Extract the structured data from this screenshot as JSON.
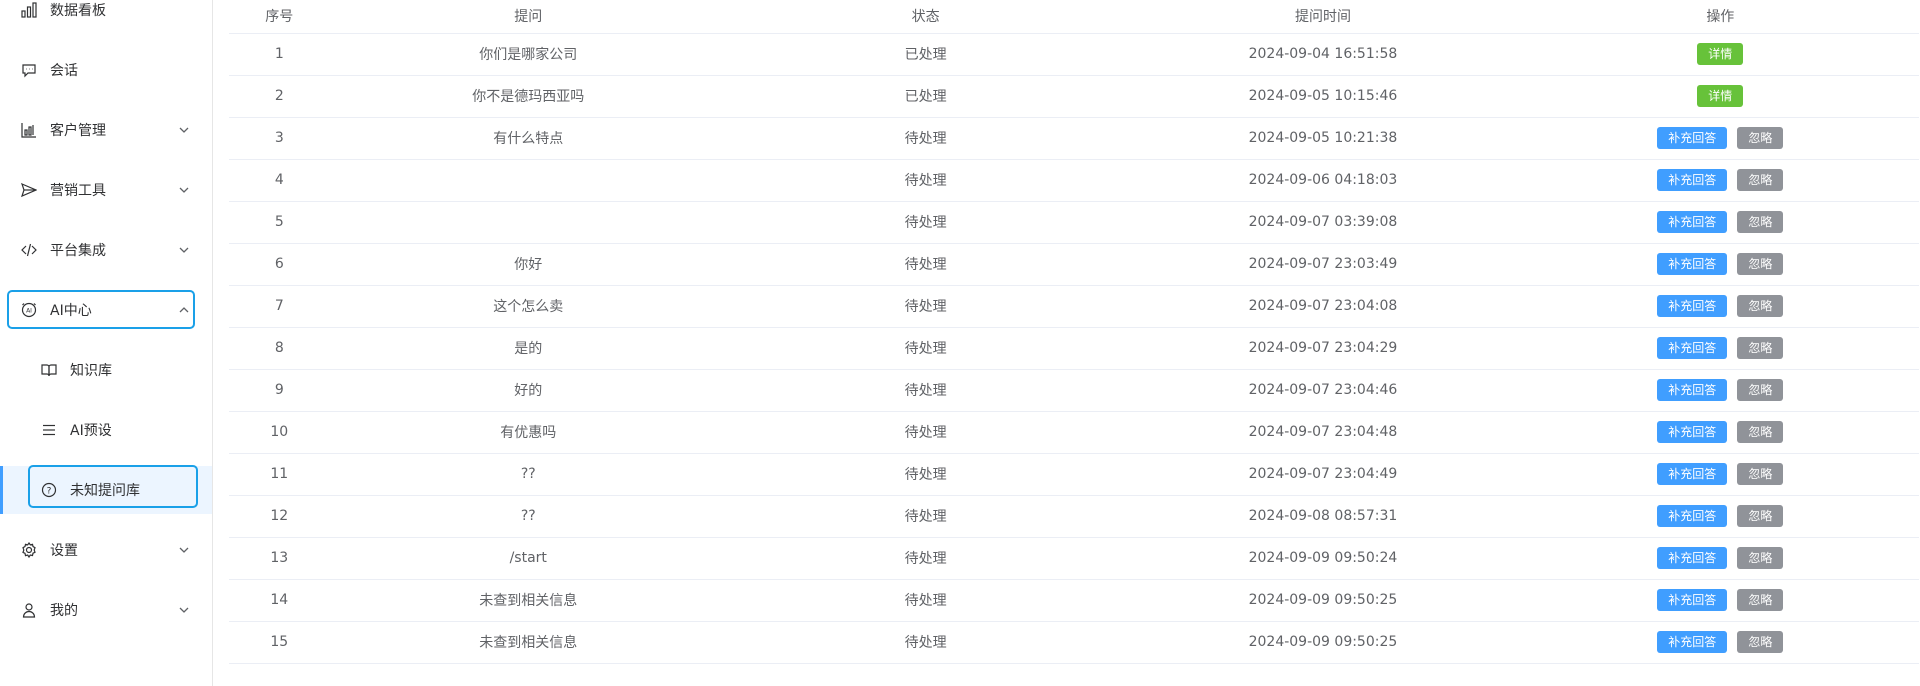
{
  "sidebar": {
    "items": [
      {
        "label": "数据看板",
        "icon": "bar-chart-icon",
        "arrow": false
      },
      {
        "label": "会话",
        "icon": "chat-bubble-icon",
        "arrow": false
      },
      {
        "label": "客户管理",
        "icon": "customer-chart-icon",
        "arrow": true
      },
      {
        "label": "营销工具",
        "icon": "send-icon",
        "arrow": true
      },
      {
        "label": "平台集成",
        "icon": "code-icon",
        "arrow": true
      },
      {
        "label": "AI中心",
        "icon": "ai-circle-icon",
        "arrow": true,
        "expanded": true
      },
      {
        "label": "知识库",
        "icon": "book-icon",
        "sub": true
      },
      {
        "label": "AI预设",
        "icon": "list-icon",
        "sub": true
      },
      {
        "label": "未知提问库",
        "icon": "question-circle-icon",
        "sub": true,
        "active": true
      },
      {
        "label": "设置",
        "icon": "gear-icon",
        "arrow": true
      },
      {
        "label": "我的",
        "icon": "user-icon",
        "arrow": true
      }
    ]
  },
  "table": {
    "headers": [
      "序号",
      "提问",
      "状态",
      "提问时间",
      "操作"
    ],
    "rows": [
      {
        "no": "1",
        "question": "你们是哪家公司",
        "status": "已处理",
        "time": "2024-09-04 16:51:58",
        "handled": true
      },
      {
        "no": "2",
        "question": "你不是德玛西亚吗",
        "status": "已处理",
        "time": "2024-09-05 10:15:46",
        "handled": true
      },
      {
        "no": "3",
        "question": "有什么特点",
        "status": "待处理",
        "time": "2024-09-05 10:21:38",
        "handled": false
      },
      {
        "no": "4",
        "question": "",
        "status": "待处理",
        "time": "2024-09-06 04:18:03",
        "handled": false
      },
      {
        "no": "5",
        "question": "",
        "status": "待处理",
        "time": "2024-09-07 03:39:08",
        "handled": false
      },
      {
        "no": "6",
        "question": "你好",
        "status": "待处理",
        "time": "2024-09-07 23:03:49",
        "handled": false
      },
      {
        "no": "7",
        "question": "这个怎么卖",
        "status": "待处理",
        "time": "2024-09-07 23:04:08",
        "handled": false
      },
      {
        "no": "8",
        "question": "是的",
        "status": "待处理",
        "time": "2024-09-07 23:04:29",
        "handled": false
      },
      {
        "no": "9",
        "question": "好的",
        "status": "待处理",
        "time": "2024-09-07 23:04:46",
        "handled": false
      },
      {
        "no": "10",
        "question": "有优惠吗",
        "status": "待处理",
        "time": "2024-09-07 23:04:48",
        "handled": false
      },
      {
        "no": "11",
        "question": "??",
        "status": "待处理",
        "time": "2024-09-07 23:04:49",
        "handled": false
      },
      {
        "no": "12",
        "question": "??",
        "status": "待处理",
        "time": "2024-09-08 08:57:31",
        "handled": false
      },
      {
        "no": "13",
        "question": "/start",
        "status": "待处理",
        "time": "2024-09-09 09:50:24",
        "handled": false
      },
      {
        "no": "14",
        "question": "未查到相关信息",
        "status": "待处理",
        "time": "2024-09-09 09:50:25",
        "handled": false
      },
      {
        "no": "15",
        "question": "未查到相关信息",
        "status": "待处理",
        "time": "2024-09-09 09:50:25",
        "handled": false
      }
    ],
    "actions": {
      "detail": "详情",
      "supplement": "补充回答",
      "ignore": "忽略"
    }
  },
  "colors": {
    "primary": "#409eff",
    "success": "#67c23a",
    "info": "#909399",
    "highlight": "#1aa0e8"
  }
}
